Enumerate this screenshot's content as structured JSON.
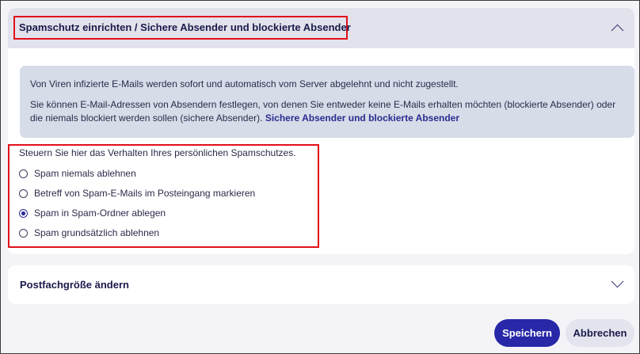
{
  "spam_panel": {
    "title": "Spamschutz einrichten / Sichere Absender und blockierte Absender",
    "expanded": true,
    "info": {
      "line1": "Von Viren infizierte E-Mails werden sofort und automatisch vom Server abgelehnt und nicht zugestellt.",
      "line2": "Sie können E-Mail-Adressen von Absendern festlegen, von denen Sie entweder keine E-Mails erhalten möchten (blockierte Absender) oder die niemals blockiert werden sollen (sichere Absender).",
      "link": "Sichere Absender und blockierte Absender"
    },
    "group_label": "Steuern Sie hier das Verhalten Ihres persönlichen Spamschutzes.",
    "options": [
      {
        "label": "Spam niemals ablehnen",
        "checked": false
      },
      {
        "label": "Betreff von Spam-E-Mails im Posteingang markieren",
        "checked": false
      },
      {
        "label": "Spam in Spam-Ordner ablegen",
        "checked": true
      },
      {
        "label": "Spam grundsätzlich ablehnen",
        "checked": false
      }
    ]
  },
  "mailbox_panel": {
    "title": "Postfachgröße ändern",
    "expanded": false
  },
  "buttons": {
    "save": "Speichern",
    "cancel": "Abbrechen"
  },
  "colors": {
    "accent": "#2727a8",
    "highlight_border": "#e0101a",
    "header_bg": "#e2e2ec",
    "info_bg": "#d6dce8"
  }
}
